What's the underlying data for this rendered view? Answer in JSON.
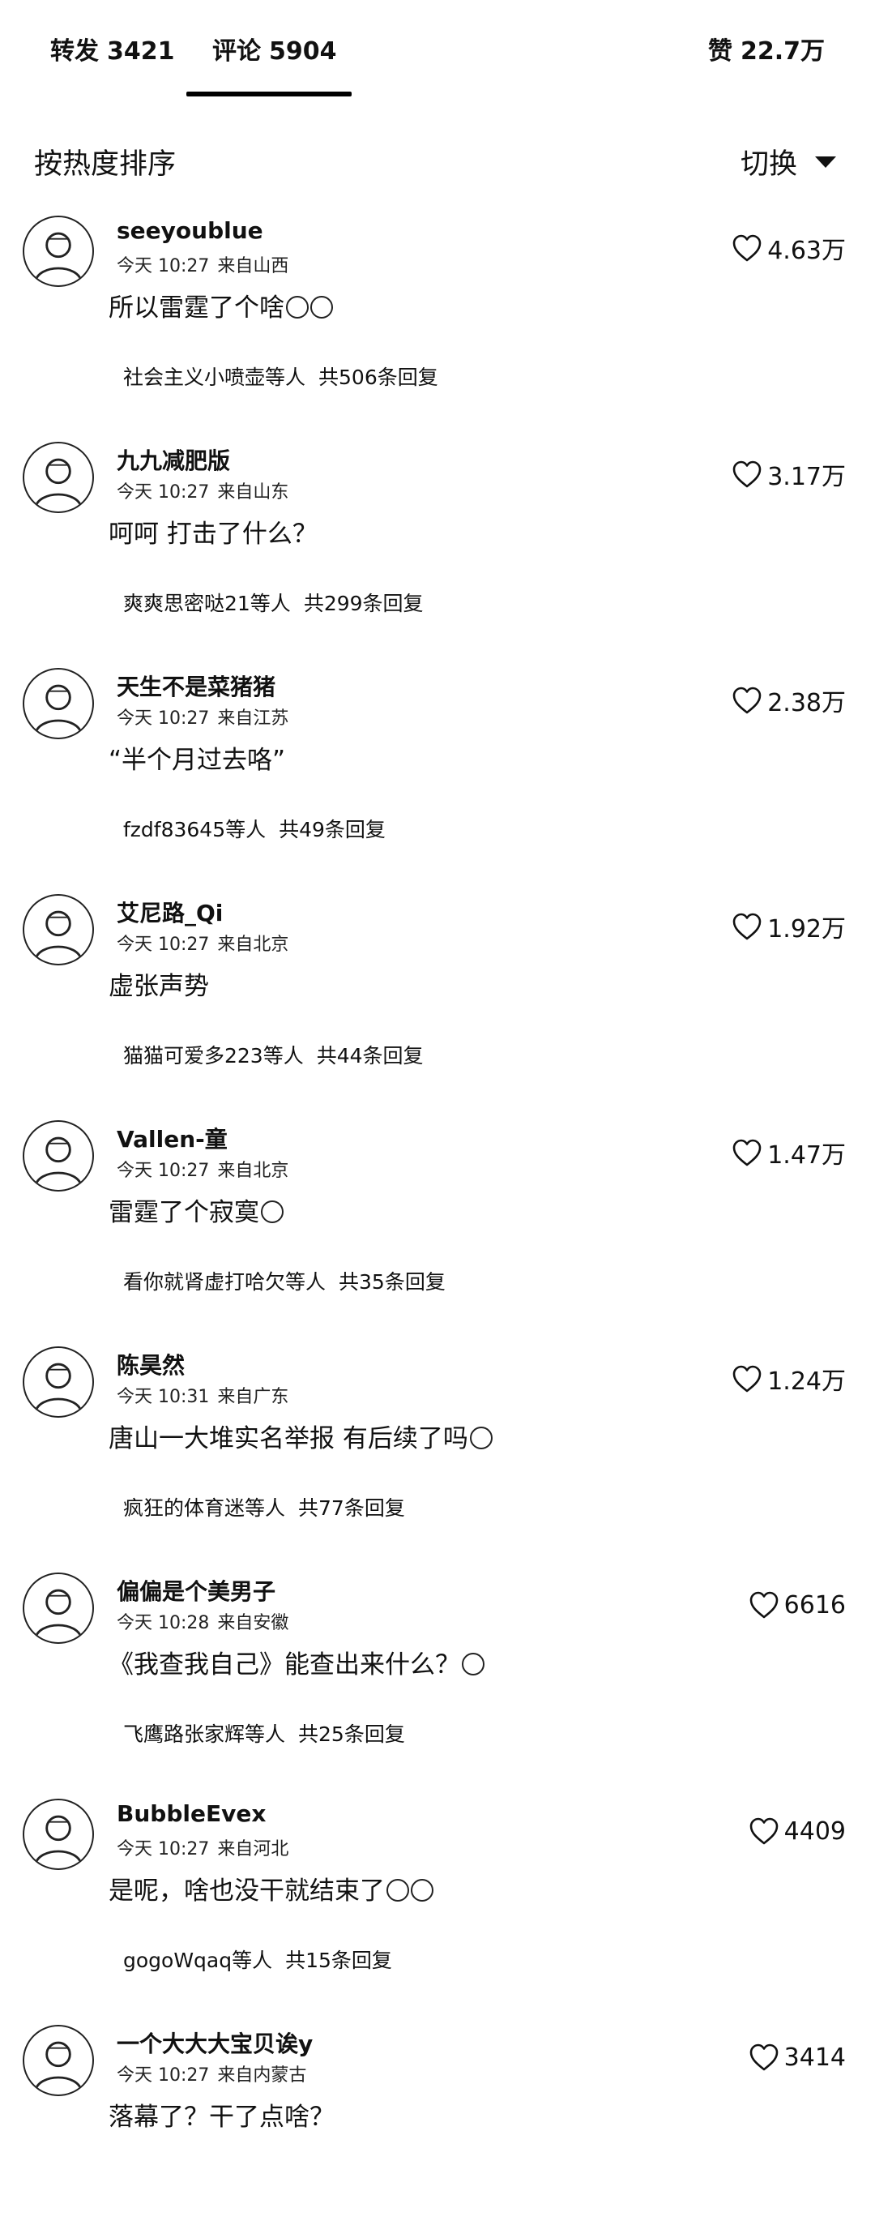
{
  "tabs": {
    "reposts": {
      "label": "转发",
      "count": "3421"
    },
    "comments": {
      "label": "评论",
      "count": "5904"
    },
    "likes": {
      "label": "赞",
      "count": "22.7万"
    }
  },
  "sort": {
    "label": "按热度排序",
    "switch_label": "切换"
  },
  "comments": [
    {
      "username": "seeyoublue",
      "time": "今天 10:27",
      "location": "来自山西",
      "text": "所以雷霆了个啥",
      "emoji": [
        "emoji",
        "emoji"
      ],
      "reply_users": "社会主义小喷壶等人",
      "reply_total": "共506条回复",
      "likes": "4.63万"
    },
    {
      "username": "九九减肥版",
      "time": "今天 10:27",
      "location": "来自山东",
      "text": "呵呵 打击了什么？",
      "emoji": [],
      "reply_users": "爽爽思密哒21等人",
      "reply_total": "共299条回复",
      "likes": "3.17万"
    },
    {
      "username": "天生不是菜猪猪",
      "time": "今天 10:27",
      "location": "来自江苏",
      "text": "“半个月过去咯”",
      "emoji": [],
      "reply_users": "fzdf83645等人",
      "reply_total": "共49条回复",
      "likes": "2.38万"
    },
    {
      "username": "艾尼路_Qi",
      "time": "今天 10:27",
      "location": "来自北京",
      "text": "虚张声势",
      "emoji": [],
      "reply_users": "猫猫可爱多223等人",
      "reply_total": "共44条回复",
      "likes": "1.92万"
    },
    {
      "username": "Vallen-童",
      "time": "今天 10:27",
      "location": "来自北京",
      "text": "雷霆了个寂寞",
      "emoji": [
        "emoji"
      ],
      "reply_users": "看你就肾虚打哈欠等人",
      "reply_total": "共35条回复",
      "likes": "1.47万"
    },
    {
      "username": "陈昊然",
      "time": "今天 10:31",
      "location": "来自广东",
      "text": "唐山一大堆实名举报 有后续了吗",
      "emoji": [
        "emoji"
      ],
      "reply_users": "疯狂的体育迷等人",
      "reply_total": "共77条回复",
      "likes": "1.24万"
    },
    {
      "username": "偏偏是个美男子",
      "time": "今天 10:28",
      "location": "来自安徽",
      "text": "《我查我自己》能查出来什么？",
      "emoji": [
        "emoji"
      ],
      "reply_users": "飞鹰路张家辉等人",
      "reply_total": "共25条回复",
      "likes": "6616"
    },
    {
      "username": "BubbleEvex",
      "time": "今天 10:27",
      "location": "来自河北",
      "text": "是呢，啥也没干就结束了",
      "emoji": [
        "emoji",
        "emoji"
      ],
      "reply_users": "gogoWqaq等人",
      "reply_total": "共15条回复",
      "likes": "4409"
    },
    {
      "username": "一个大大大宝贝诶y",
      "time": "今天 10:27",
      "location": "来自内蒙古",
      "text": "落幕了？干了点啥？",
      "emoji": [],
      "reply_users": "",
      "reply_total": "",
      "likes": "3414"
    }
  ]
}
